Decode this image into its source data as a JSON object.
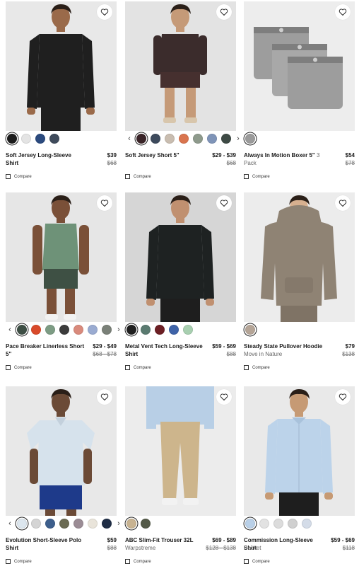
{
  "compare_label": "Compare",
  "wishlist_icon": "heart-outline-icon",
  "products": [
    {
      "name": "Soft Jersey Long-Sleeve Shirt",
      "pack": "",
      "subtitle": "",
      "price": "$39",
      "was_price": "$68",
      "swatches": [
        "#1c1c1c",
        "#e4e4e4",
        "#2b4a7e",
        "#3f4b5c"
      ],
      "selected": 0,
      "nav_prev": false,
      "nav_next": false,
      "image": {
        "bg": "#e8e8e8",
        "garment": "#1f1f1f",
        "pants": "#1f1f1f",
        "skin": "#9a6a4a",
        "kind": "longsleeve"
      }
    },
    {
      "name": "Soft Jersey Short 5\"",
      "pack": "",
      "subtitle": "",
      "price": "$29 - $39",
      "was_price": "$68",
      "swatches": [
        "#3a2428",
        "#3d4a5c",
        "#c9bdb0",
        "#d9744e",
        "#8e9a8c",
        "#7f94b8",
        "#3e4a45"
      ],
      "selected": 0,
      "nav_prev": true,
      "nav_next": true,
      "image": {
        "bg": "#e3e3e3",
        "garment": "#3b2c2c",
        "pants": "#46302f",
        "skin": "#c59a78",
        "kind": "shorts"
      }
    },
    {
      "name": "Always In Motion Boxer 5\"",
      "pack": "3 Pack",
      "subtitle": "",
      "price": "$54",
      "was_price": "$78",
      "swatches": [
        "#9b9b9b"
      ],
      "selected": 0,
      "nav_prev": false,
      "nav_next": false,
      "image": {
        "bg": "#ededed",
        "garment": "#9d9d9d",
        "pants": "#9d9d9d",
        "skin": "#9d9d9d",
        "kind": "boxer"
      }
    },
    {
      "name": "Pace Breaker Linerless Short 5\"",
      "pack": "",
      "subtitle": "",
      "price": "$29 - $49",
      "was_price": "$68 - $78",
      "swatches": [
        "#3e4f45",
        "#d94a2a",
        "#7d9c84",
        "#3b3b3b",
        "#d98a7c",
        "#9aabd1",
        "#7a8078"
      ],
      "selected": 0,
      "nav_prev": true,
      "nav_next": true,
      "image": {
        "bg": "#e6e6e6",
        "garment": "#6e9278",
        "pants": "#3e5044",
        "skin": "#7a5038",
        "kind": "tank"
      }
    },
    {
      "name": "Metal Vent Tech Long-Sleeve Shirt",
      "pack": "",
      "subtitle": "",
      "price": "$59 - $69",
      "was_price": "$88",
      "swatches": [
        "#1f1f1f",
        "#5a7a70",
        "#6c1f24",
        "#3e63a8",
        "#a8cfb0"
      ],
      "selected": 0,
      "nav_prev": false,
      "nav_next": false,
      "image": {
        "bg": "#d6d6d6",
        "garment": "#1e2222",
        "pants": "#1e1e1e",
        "skin": "#c09070",
        "kind": "longsleeve"
      }
    },
    {
      "name": "Steady State Pullover Hoodie",
      "pack": "",
      "subtitle": "Move in Nature",
      "price": "$79",
      "was_price": "$138",
      "swatches": [
        "#b5a597"
      ],
      "selected": 0,
      "nav_prev": false,
      "nav_next": false,
      "image": {
        "bg": "#ececec",
        "garment": "#8f8374",
        "pants": "#7f7365",
        "skin": "#d7b08f",
        "kind": "hoodie"
      }
    },
    {
      "name": "Evolution Short-Sleeve Polo Shirt",
      "pack": "",
      "subtitle": "",
      "price": "$59",
      "was_price": "$88",
      "swatches": [
        "#dce6ee",
        "#d4d4d4",
        "#3d5f8c",
        "#6a6a52",
        "#9b8c95",
        "#e9e4da",
        "#1f2d45"
      ],
      "selected": 0,
      "nav_prev": true,
      "nav_next": true,
      "image": {
        "bg": "#e8e8e8",
        "garment": "#d6e2ec",
        "pants": "#1e3a8a",
        "skin": "#6b4a36",
        "kind": "polo"
      }
    },
    {
      "name": "ABC Slim-Fit Trouser 32L",
      "pack": "",
      "subtitle": "Warpstreme",
      "price": "$69 - $89",
      "was_price": "$128 - $138",
      "swatches": [
        "#c8b391",
        "#545a48"
      ],
      "selected": 0,
      "nav_prev": false,
      "nav_next": false,
      "image": {
        "bg": "#ececec",
        "garment": "#b8cfe6",
        "pants": "#cdb58c",
        "skin": "#c59a78",
        "kind": "trouser"
      }
    },
    {
      "name": "Commission Long-Sleeve Shirt",
      "pack": "",
      "subtitle": "Pocket",
      "price": "$59 - $69",
      "was_price": "$118",
      "swatches": [
        "#b9d0e8",
        "#e2e2e2",
        "#dcdcdc",
        "#d0d0d0",
        "#d4dce8"
      ],
      "selected": 0,
      "nav_prev": false,
      "nav_next": false,
      "image": {
        "bg": "#e9e9e9",
        "garment": "#bcd3ea",
        "pants": "#1e1e1e",
        "skin": "#c69a74",
        "kind": "buttonshirt"
      }
    }
  ]
}
